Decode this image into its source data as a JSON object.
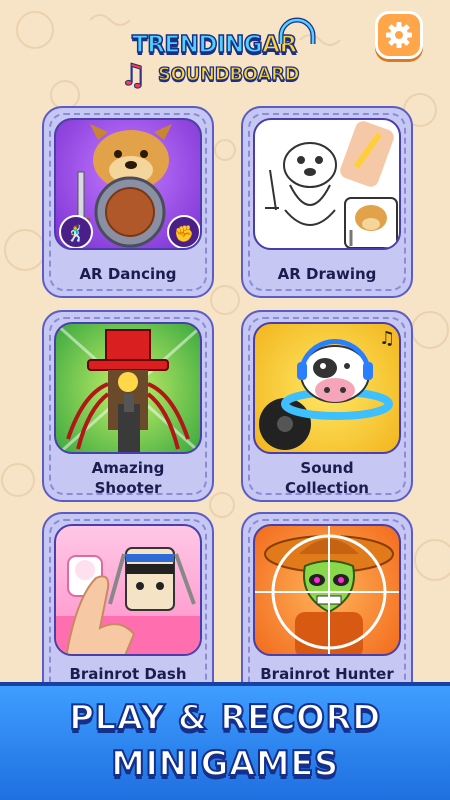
{
  "header": {
    "logo_line1_part1": "TRENDING",
    "logo_line1_part2": "AR",
    "logo_line2": "SOUNDBOARD",
    "settings_icon": "gear-icon"
  },
  "cards": [
    {
      "label": "AR Dancing",
      "image": "dancing-dog-with-shield"
    },
    {
      "label": "AR Drawing",
      "image": "drawing-sketch-dog"
    },
    {
      "label_line1": "Amazing",
      "label_line2": "Shooter",
      "image": "spider-hat-character-with-gun"
    },
    {
      "label_line1": "Sound",
      "label_line2": "Collection",
      "image": "cow-with-headphones-vinyl"
    },
    {
      "label": "Brainrot Dash",
      "image": "ninja-dash-hand"
    },
    {
      "label": "Brainrot Hunter",
      "image": "skull-target-crosshair"
    }
  ],
  "banner": {
    "line1": "PLAY & RECORD",
    "line2": "MINIGAMES"
  }
}
